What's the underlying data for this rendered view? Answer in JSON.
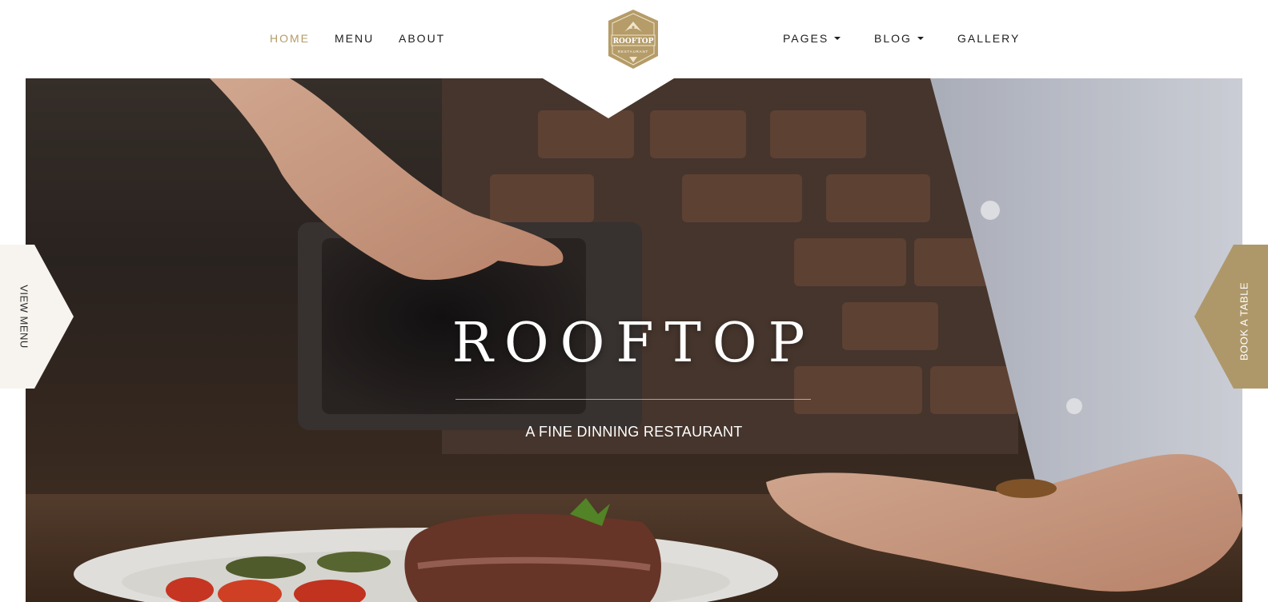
{
  "nav": {
    "left": [
      {
        "label": "HOME",
        "active": true
      },
      {
        "label": "MENU"
      },
      {
        "label": "ABOUT"
      }
    ],
    "right": [
      {
        "label": "PAGES",
        "dropdown": true
      },
      {
        "label": "BLOG",
        "dropdown": true
      },
      {
        "label": "GALLERY"
      }
    ]
  },
  "logo": {
    "name": "ROOFTOP",
    "tagline": "RESTAURANT",
    "icon": "pizza-slice-icon"
  },
  "hero": {
    "title": "ROOFTOP",
    "subtitle": "A FINE DINNING RESTAURANT"
  },
  "side_tabs": {
    "left": "VIEW MENU",
    "right": "BOOK A TABLE"
  },
  "colors": {
    "accent": "#b59c68",
    "nav_text": "#1e1e1e",
    "side_tab_left_bg": "#f7f4ef",
    "side_tab_right_bg": "#ae986a"
  }
}
